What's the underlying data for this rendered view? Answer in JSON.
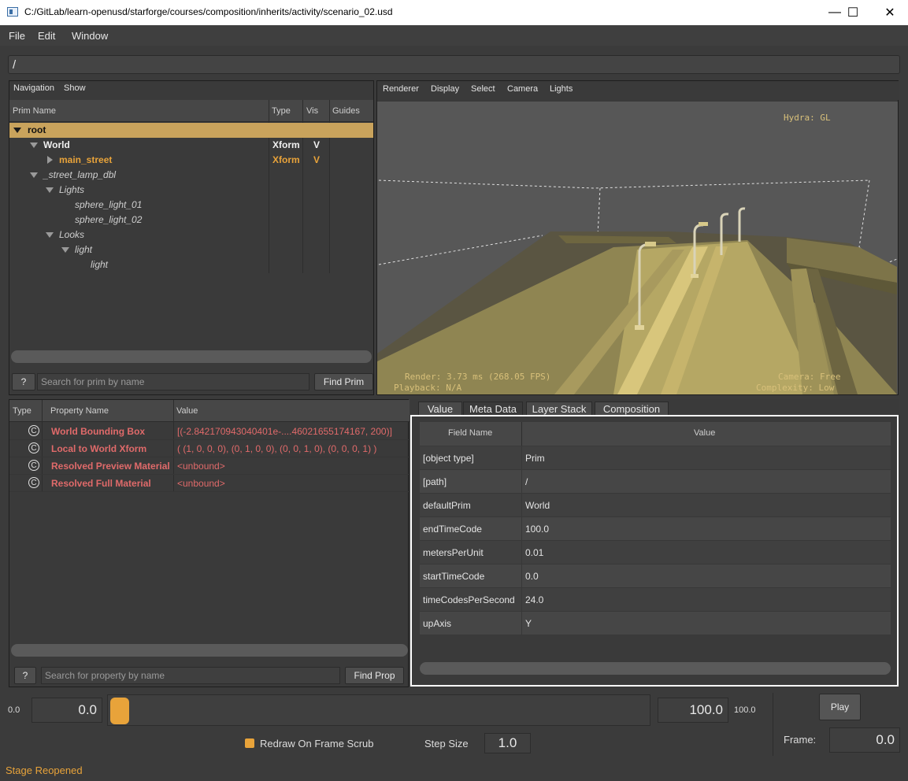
{
  "window": {
    "title": "C:/GitLab/learn-openusd/starforge/courses/composition/inherits/activity/scenario_02.usd",
    "minimize": "—",
    "maximize": "☐",
    "close": "✕"
  },
  "menubar": [
    "File",
    "Edit",
    "Window"
  ],
  "path": "/",
  "prim_panel": {
    "toolbar": [
      "Navigation",
      "Show"
    ],
    "columns": [
      "Prim Name",
      "Type",
      "Vis",
      "Guides"
    ],
    "rows": [
      {
        "name": "root",
        "type": "",
        "vis": ""
      },
      {
        "name": "World",
        "type": "Xform",
        "vis": "V"
      },
      {
        "name": "main_street",
        "type": "Xform",
        "vis": "V"
      },
      {
        "name": "_street_lamp_dbl",
        "type": "",
        "vis": ""
      },
      {
        "name": "Lights",
        "type": "",
        "vis": ""
      },
      {
        "name": "sphere_light_01",
        "type": "",
        "vis": ""
      },
      {
        "name": "sphere_light_02",
        "type": "",
        "vis": ""
      },
      {
        "name": "Looks",
        "type": "",
        "vis": ""
      },
      {
        "name": "light",
        "type": "",
        "vis": ""
      },
      {
        "name": "light",
        "type": "",
        "vis": ""
      }
    ],
    "help_button": "?",
    "search_placeholder": "Search for prim by name",
    "find_button": "Find Prim"
  },
  "viewport": {
    "menu": [
      "Renderer",
      "Display",
      "Select",
      "Camera",
      "Lights"
    ],
    "hud_renderer": "Hydra: GL",
    "hud_render": "Render: 3.73 ms (268.05 FPS)",
    "hud_playback": "Playback: N/A",
    "hud_camera": "Camera: Free",
    "hud_complexity": "Complexity: Low"
  },
  "prop_panel": {
    "columns": [
      "Type",
      "Property Name",
      "Value"
    ],
    "rows": [
      {
        "icon": "C",
        "name": "World Bounding Box",
        "value": "[(-2.842170943040401e-....46021655174167, 200)]"
      },
      {
        "icon": "C",
        "name": "Local to World Xform",
        "value": "( (1, 0, 0, 0), (0, 1, 0, 0), (0, 0, 1, 0), (0, 0, 0, 1) )"
      },
      {
        "icon": "C",
        "name": "Resolved Preview Material",
        "value": "<unbound>"
      },
      {
        "icon": "C",
        "name": "Resolved Full Material",
        "value": "<unbound>"
      }
    ],
    "help_button": "?",
    "search_placeholder": "Search for property by name",
    "find_button": "Find Prop"
  },
  "meta_panel": {
    "tabs": [
      "Value",
      "Meta Data",
      "Layer Stack",
      "Composition"
    ],
    "columns": [
      "Field Name",
      "Value"
    ],
    "rows": [
      {
        "key": "[object type]",
        "value": "Prim"
      },
      {
        "key": "[path]",
        "value": "/"
      },
      {
        "key": "defaultPrim",
        "value": "World"
      },
      {
        "key": "endTimeCode",
        "value": "100.0"
      },
      {
        "key": "metersPerUnit",
        "value": "0.01"
      },
      {
        "key": "startTimeCode",
        "value": "0.0"
      },
      {
        "key": "timeCodesPerSecond",
        "value": "24.0"
      },
      {
        "key": "upAxis",
        "value": "Y"
      }
    ]
  },
  "timeline": {
    "min_label": "0.0",
    "start_value": "0.0",
    "end_value": "100.0",
    "max_label": "100.0",
    "play_button": "Play",
    "frame_label": "Frame:",
    "frame_value": "0.0",
    "redraw_label": "Redraw On Frame Scrub",
    "step_label": "Step Size",
    "step_value": "1.0",
    "slider_position": 0
  },
  "status": "Stage Reopened",
  "colors": {
    "selection": "#c9a35c",
    "accent": "#e8a33a",
    "property_text": "#e06a6a"
  }
}
